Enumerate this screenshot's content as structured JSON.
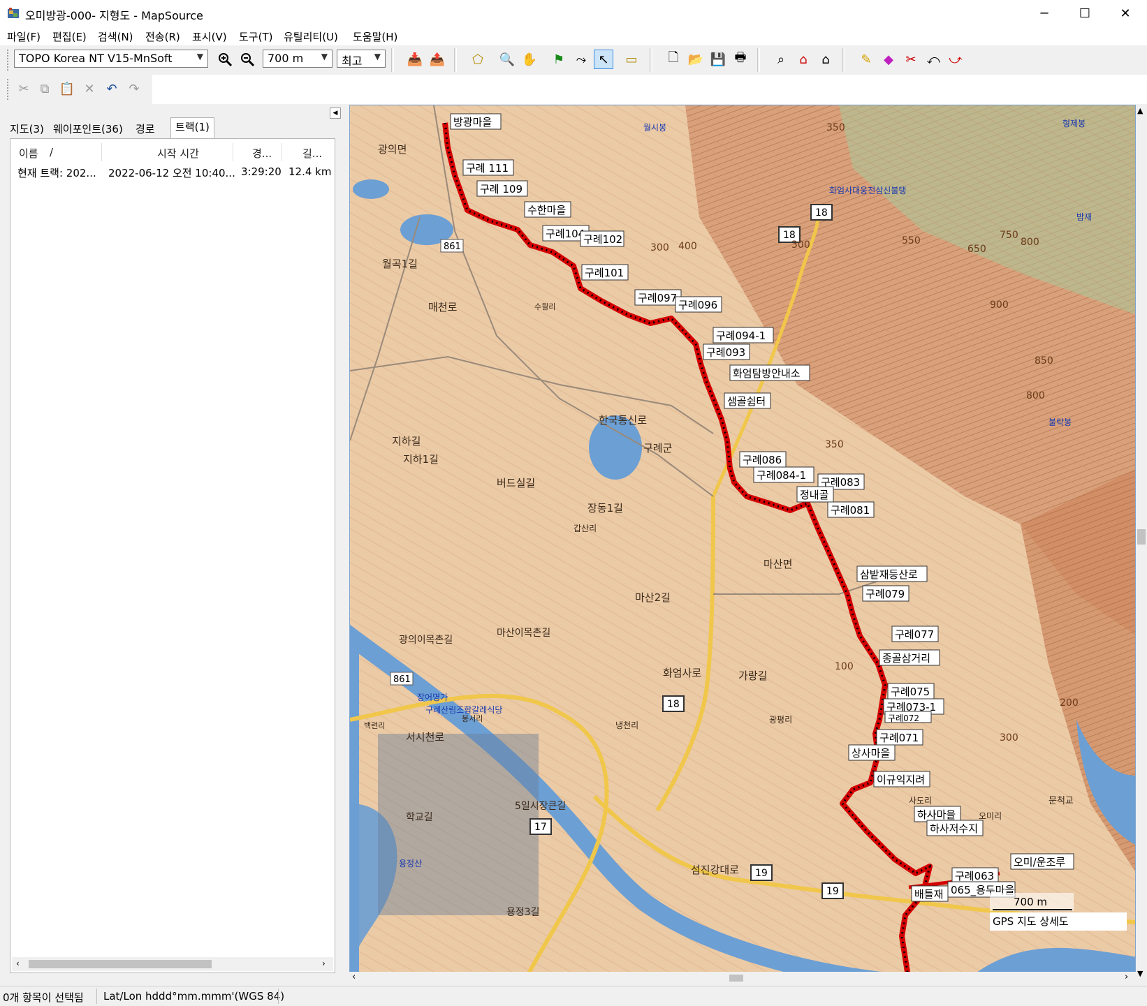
{
  "window": {
    "title": "오미방광-000- 지형도 - MapSource",
    "minimize": "─",
    "maximize": "☐",
    "close": "✕"
  },
  "menu": [
    "파일(F)",
    "편집(E)",
    "검색(N)",
    "전송(R)",
    "표시(V)",
    "도구(T)",
    "유틸리티(U)",
    "도움말(H)"
  ],
  "toolbar": {
    "map_product": "TOPO Korea NT V15-MnSoft",
    "zoom_scale": "700 m",
    "detail": "최고"
  },
  "tabs": [
    "지도(3)",
    "웨이포인트(36)",
    "경로",
    "트랙(1)"
  ],
  "track_list": {
    "columns": [
      "이름",
      "시작 시간",
      "경...",
      "길..."
    ],
    "sort_indicator": "/",
    "rows": [
      {
        "name": "현재 트랙: 202...",
        "start": "2022-06-12 오전 10:40...",
        "duration": "3:29:20",
        "length": "12.4 km"
      }
    ]
  },
  "map": {
    "scale_label": "700 m",
    "detail_label": "GPS 지도 상세도",
    "colors": {
      "land": "#e9c9a4",
      "contour": "#c98a5a",
      "water": "#5f93c9",
      "track": "#e00000",
      "road": "#f0c74a",
      "forest": "#c77d55"
    },
    "waypoints": [
      "방광마을",
      "구례 111",
      "구례 109",
      "수한마을",
      "구례104",
      "구례102",
      "구례101",
      "구례097",
      "구례096",
      "구례094-1",
      "구례093",
      "화엄탐방안내소",
      "샘골쉼터",
      "구례086",
      "구례084-1",
      "구례083",
      "정내골",
      "구례081",
      "삼밭재등산로",
      "구례079",
      "구례077",
      "종골삼거리",
      "구례075",
      "구례073-1",
      "구례072",
      "구례071",
      "상사마을",
      "이규익지려",
      "하사마을",
      "하사저수지",
      "오미/운조루",
      "구례063",
      "065_용두마을",
      "배틀재"
    ],
    "place_labels": [
      "광의면",
      "월곡1길",
      "매천로",
      "구례군",
      "마산면",
      "지하길",
      "지하1길",
      "버드실길",
      "한국통신로",
      "장동1길",
      "갑산리",
      "마산2길",
      "화엄사로",
      "서시천로",
      "가랑길",
      "광평리",
      "냉천리",
      "섬진강대로",
      "사도리",
      "오미리",
      "문척교",
      "화엄사대웅전삼신불탱",
      "월시봉",
      "형제봉",
      "밤재",
      "불락봉",
      "수월리",
      "광의이목촌길",
      "마산이목촌길",
      "용정산",
      "학교길",
      "5일시장큰길",
      "봉서리",
      "백련리",
      "용정3길",
      "구례산림조합갈레식당",
      "장어명가"
    ],
    "contour_labels": [
      "350",
      "300",
      "400",
      "550",
      "650",
      "750",
      "800",
      "900",
      "850",
      "800",
      "350",
      "300",
      "100",
      "200",
      "300"
    ],
    "route_numbers": [
      "861",
      "861",
      "18",
      "18",
      "18",
      "17",
      "19",
      "19"
    ]
  },
  "status": {
    "selection": "0개 항목이 선택됨",
    "coords_format": "Lat/Lon hddd°mm.mmm'(WGS 84)"
  }
}
